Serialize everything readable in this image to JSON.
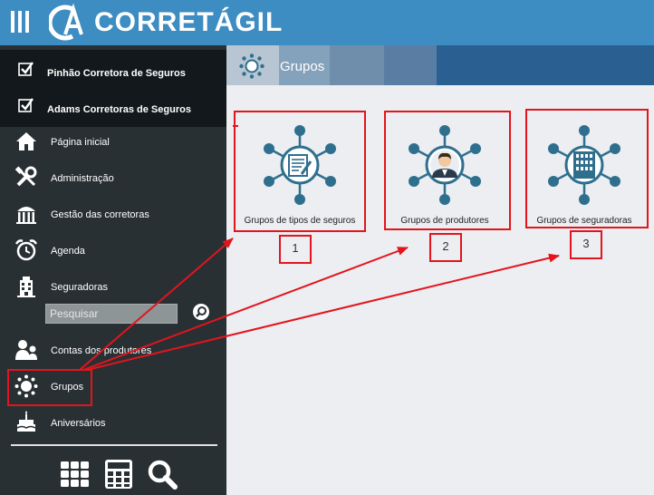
{
  "brand": {
    "name": "CORRETÁGIL",
    "logo_text": "CA"
  },
  "header": {
    "menu_icon": "menu-bars-icon"
  },
  "sidebar": {
    "brokers": [
      {
        "label": "Pinhão Corretora de Seguros"
      },
      {
        "label": "Adams Corretoras de Seguros"
      }
    ],
    "items": [
      {
        "label": "Página inicial",
        "icon": "home-icon"
      },
      {
        "label": "Administração",
        "icon": "tools-icon"
      },
      {
        "label": "Gestão das corretoras",
        "icon": "bank-icon"
      },
      {
        "label": "Agenda",
        "icon": "alarm-clock-icon"
      },
      {
        "label": "Seguradoras",
        "icon": "building-icon"
      },
      {
        "label": "Contas dos produtores",
        "icon": "users-icon"
      },
      {
        "label": "Grupos",
        "icon": "groups-icon"
      },
      {
        "label": "Aniversários",
        "icon": "cake-icon"
      }
    ],
    "search": {
      "placeholder": "Pesquisar"
    },
    "bottom_icons": [
      "grid-icon",
      "calculator-icon",
      "search-icon"
    ]
  },
  "page": {
    "title": "Grupos"
  },
  "cards": [
    {
      "label": "Grupos de tipos de seguros",
      "icon": "document-hub-icon"
    },
    {
      "label": "Grupos de produtores",
      "icon": "person-hub-icon"
    },
    {
      "label": "Grupos de seguradoras",
      "icon": "building-hub-icon"
    }
  ],
  "annotations": [
    "1",
    "2",
    "3"
  ],
  "colors": {
    "topbar": "#3d8cc2",
    "sidebar": "#283034",
    "accent": "#2f6f8e",
    "annotation": "#e3141c"
  }
}
